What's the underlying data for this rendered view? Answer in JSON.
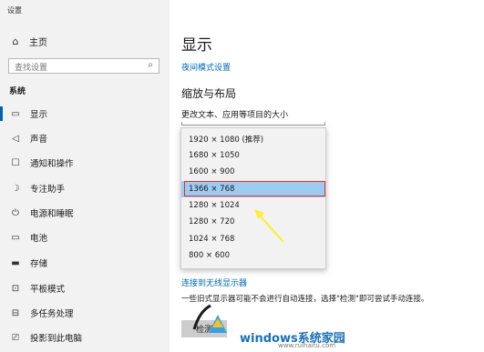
{
  "window": {
    "title": "设置"
  },
  "sidebar": {
    "home": {
      "icon": "home-icon",
      "label": "主页"
    },
    "search": {
      "placeholder": "查找设置",
      "icon": "search-icon"
    },
    "section": "系统",
    "items": [
      {
        "icon": "monitor-icon",
        "label": "显示",
        "active": true
      },
      {
        "icon": "speaker-icon",
        "label": "声音"
      },
      {
        "icon": "notification-icon",
        "label": "通知和操作"
      },
      {
        "icon": "moon-icon",
        "label": "专注助手"
      },
      {
        "icon": "power-icon",
        "label": "电源和睡眠"
      },
      {
        "icon": "battery-icon",
        "label": "电池"
      },
      {
        "icon": "storage-icon",
        "label": "存储"
      },
      {
        "icon": "tablet-icon",
        "label": "平板模式"
      },
      {
        "icon": "multitask-icon",
        "label": "多任务处理"
      },
      {
        "icon": "project-icon",
        "label": "投影到此电脑"
      }
    ]
  },
  "main": {
    "title": "显示",
    "night_light_link": "夜间模式设置",
    "scale_heading": "缩放与布局",
    "scale_desc": "更改文本、应用等项目的大小",
    "resolution_options": [
      "1920 × 1080 (推荐)",
      "1680 × 1050",
      "1600 × 900",
      "1366 × 768",
      "1280 × 1024",
      "1280 × 720",
      "1024 × 768",
      "800 × 600"
    ],
    "selected_resolution": "1366 × 768",
    "wireless_link": "连接到无线显示器",
    "note": "一些旧式显示器可能不会进行自动连接，选择\"检测\"即可尝试手动连接。",
    "detect_button": "检测"
  },
  "watermark": {
    "brand": "windows系统家园",
    "url": "www.ruihaitu.com"
  },
  "colors": {
    "accent": "#0063b1",
    "link": "#0067b8",
    "selected": "#9ecbf0",
    "highlight_outline": "#e03030",
    "arrow": "#ffee33"
  }
}
